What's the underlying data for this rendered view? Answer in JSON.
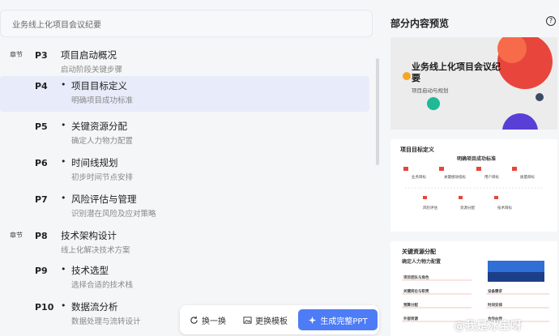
{
  "search": {
    "text": "业务线上化项目会议纪要"
  },
  "outline": [
    {
      "chapter": "章节",
      "page": "P3",
      "title": "项目启动概况",
      "subtitle": "启动阶段关键步骤",
      "bullet": ""
    },
    {
      "chapter": "",
      "page": "P4",
      "title": "项目目标定义",
      "subtitle": "明确项目成功标准",
      "bullet": "•"
    },
    {
      "chapter": "",
      "page": "P5",
      "title": "关键资源分配",
      "subtitle": "确定人力物力配置",
      "bullet": "•"
    },
    {
      "chapter": "",
      "page": "P6",
      "title": "时间线规划",
      "subtitle": "初步时间节点安排",
      "bullet": "•"
    },
    {
      "chapter": "",
      "page": "P7",
      "title": "风险评估与管理",
      "subtitle": "识别潜在风险及应对策略",
      "bullet": "•"
    },
    {
      "chapter": "章节",
      "page": "P8",
      "title": "技术架构设计",
      "subtitle": "线上化解决技术方案",
      "bullet": ""
    },
    {
      "chapter": "",
      "page": "P9",
      "title": "技术选型",
      "subtitle": "选择合适的技术栈",
      "bullet": "•"
    },
    {
      "chapter": "",
      "page": "P10",
      "title": "数据流分析",
      "subtitle": "数据处理与流转设计",
      "bullet": "•"
    }
  ],
  "preview": {
    "heading": "部分内容预览",
    "help": "?",
    "card1": {
      "title": "业务线上化项目会议纪要",
      "subtitle": "项目启动与规划"
    },
    "card2": {
      "title": "项目目标定义",
      "mid": "明确项目成功标准",
      "items": [
        "业务目标",
        "关键绩效指标",
        "用户目标",
        "质量目标",
        "风险评估",
        "资源分配",
        "技术目标"
      ]
    },
    "card3": {
      "title": "关键资源分配",
      "subtitle": "确定人力物力配置",
      "items": [
        "项目团队与角色",
        "关键岗位与职责",
        "预算分配",
        "外部资源",
        "设备需求",
        "时间安排",
        "合作伙伴"
      ]
    }
  },
  "toolbar": {
    "shuffle": "换一换",
    "template": "更换模板",
    "generate": "生成完整PPT"
  },
  "watermark": "@我是冰宝呀",
  "colors": {
    "accent": "#4d7cf6",
    "selected": "#e8ecfa",
    "red": "#e8453c",
    "orange": "#f5a623"
  }
}
